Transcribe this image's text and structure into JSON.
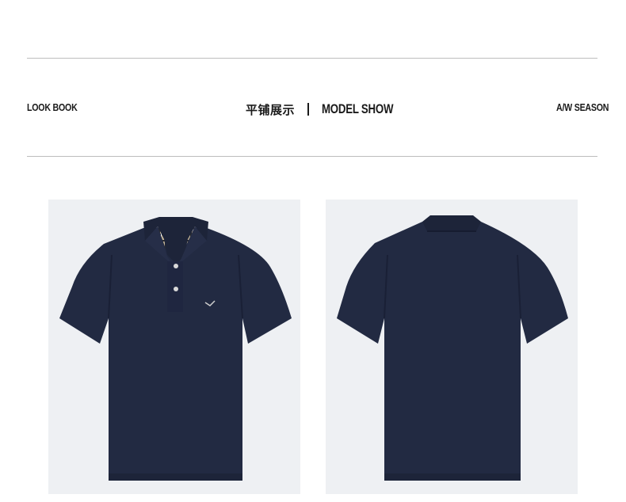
{
  "header": {
    "left_tag": "LOOK BOOK",
    "title_cn": "平铺展示",
    "title_en": "MODEL SHOW",
    "right_tag": "A/W SEASON"
  },
  "products": [
    {
      "view": "front",
      "icon": "polo-shirt-front-icon",
      "color": "#222a42"
    },
    {
      "view": "back",
      "icon": "polo-shirt-back-icon",
      "color": "#222a42"
    }
  ],
  "colors": {
    "shirt": "#222a42",
    "photo_bg": "#eef0f3",
    "rule": "#bdbdbd",
    "text": "#1a1a1a"
  }
}
